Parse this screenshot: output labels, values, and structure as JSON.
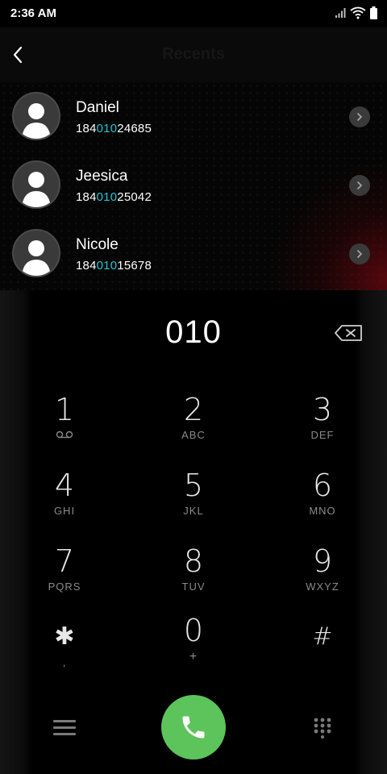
{
  "status_bar": {
    "time": "2:36 AM"
  },
  "header": {
    "title": "Recents"
  },
  "recents": [
    {
      "name": "Daniel",
      "number_pre": "184",
      "number_match": "010",
      "number_post": "24685"
    },
    {
      "name": "Jeesica",
      "number_pre": "184",
      "number_match": "010",
      "number_post": "25042"
    },
    {
      "name": "Nicole",
      "number_pre": "184",
      "number_match": "010",
      "number_post": "15678"
    }
  ],
  "dialer": {
    "entered": "010",
    "keys": [
      {
        "digit": "1",
        "letters": ""
      },
      {
        "digit": "2",
        "letters": "ABC"
      },
      {
        "digit": "3",
        "letters": "DEF"
      },
      {
        "digit": "4",
        "letters": "GHI"
      },
      {
        "digit": "5",
        "letters": "JKL"
      },
      {
        "digit": "6",
        "letters": "MNO"
      },
      {
        "digit": "7",
        "letters": "PQRS"
      },
      {
        "digit": "8",
        "letters": "TUV"
      },
      {
        "digit": "9",
        "letters": "WXYZ"
      },
      {
        "digit": "✱",
        "letters": ","
      },
      {
        "digit": "0",
        "letters": "+"
      },
      {
        "digit": "#",
        "letters": ""
      }
    ]
  },
  "colors": {
    "match_highlight": "#20c5d4",
    "call_button": "#5cc45a",
    "background": "#000000"
  },
  "icons": [
    "back-arrow-icon",
    "chevron-right-icon",
    "backspace-icon",
    "voicemail-icon",
    "menu-icon",
    "phone-icon",
    "keypad-icon",
    "signal-icon",
    "wifi-icon",
    "battery-icon"
  ]
}
